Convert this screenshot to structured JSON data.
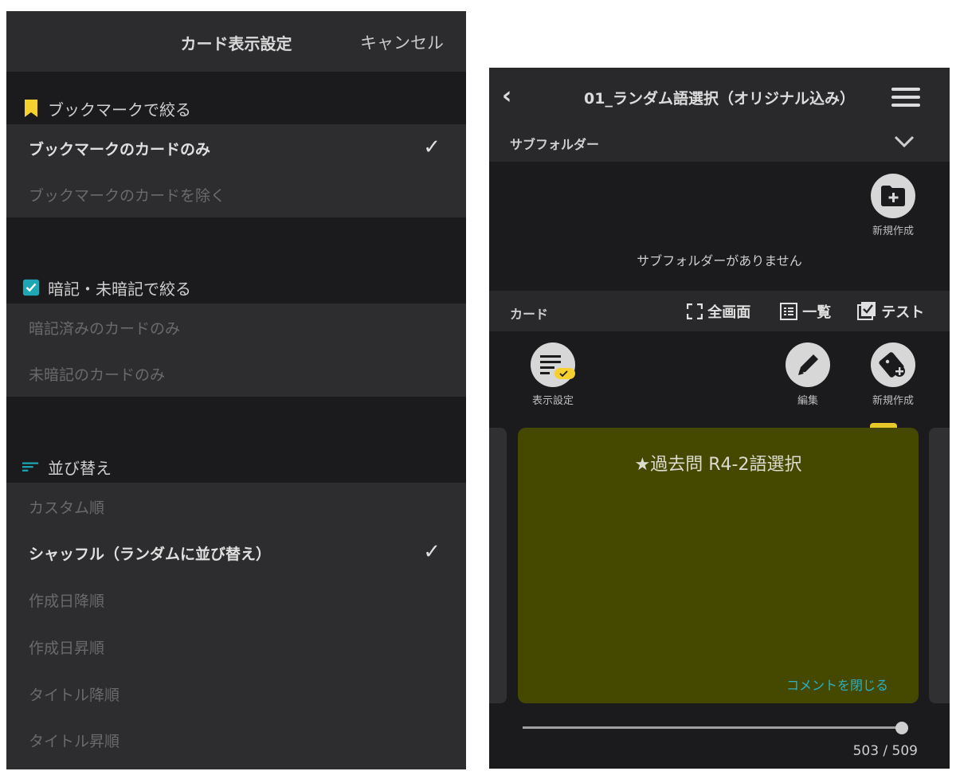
{
  "settings_panel": {
    "title": "カード表示設定",
    "cancel_label": "キャンセル",
    "sections": [
      {
        "heading": "ブックマークで絞る",
        "icon": "bookmark-icon",
        "items": [
          {
            "label": "ブックマークのカードのみ",
            "selected": true
          },
          {
            "label": "ブックマークのカードを除く",
            "selected": false
          }
        ]
      },
      {
        "heading": "暗記・未暗記で絞る",
        "icon": "checkbox-icon",
        "items": [
          {
            "label": "暗記済みのカードのみ",
            "selected": false
          },
          {
            "label": "未暗記のカードのみ",
            "selected": false
          }
        ]
      },
      {
        "heading": "並び替え",
        "icon": "sort-icon",
        "items": [
          {
            "label": "カスタム順",
            "selected": false
          },
          {
            "label": "シャッフル（ランダムに並び替え）",
            "selected": true
          },
          {
            "label": "作成日降順",
            "selected": false
          },
          {
            "label": "作成日昇順",
            "selected": false
          },
          {
            "label": "タイトル降順",
            "selected": false
          },
          {
            "label": "タイトル昇順",
            "selected": false
          }
        ]
      }
    ],
    "checkmark": "✓"
  },
  "folder_screen": {
    "title": "01_ランダム語選択（オリジナル込み）",
    "subfolder_label": "サブフォルダー",
    "new_folder_label": "新規作成",
    "empty_subfolder_text": "サブフォルダーがありません",
    "card_section_label": "カード",
    "tools": {
      "fullscreen": "全画面",
      "list": "一覧",
      "test": "テスト"
    },
    "actions": {
      "display_settings": "表示設定",
      "edit": "編集",
      "new_card": "新規作成"
    },
    "card": {
      "title": "★過去問 R4-2語選択",
      "comment_link": "コメントを閉じる"
    },
    "progress": {
      "current": 503,
      "total": 509,
      "text": "503 / 509"
    },
    "colors": {
      "card_bg": "#454900",
      "accent_yellow": "#f5d02f",
      "accent_teal": "#1fa6b5",
      "link": "#2bb0c4"
    }
  }
}
